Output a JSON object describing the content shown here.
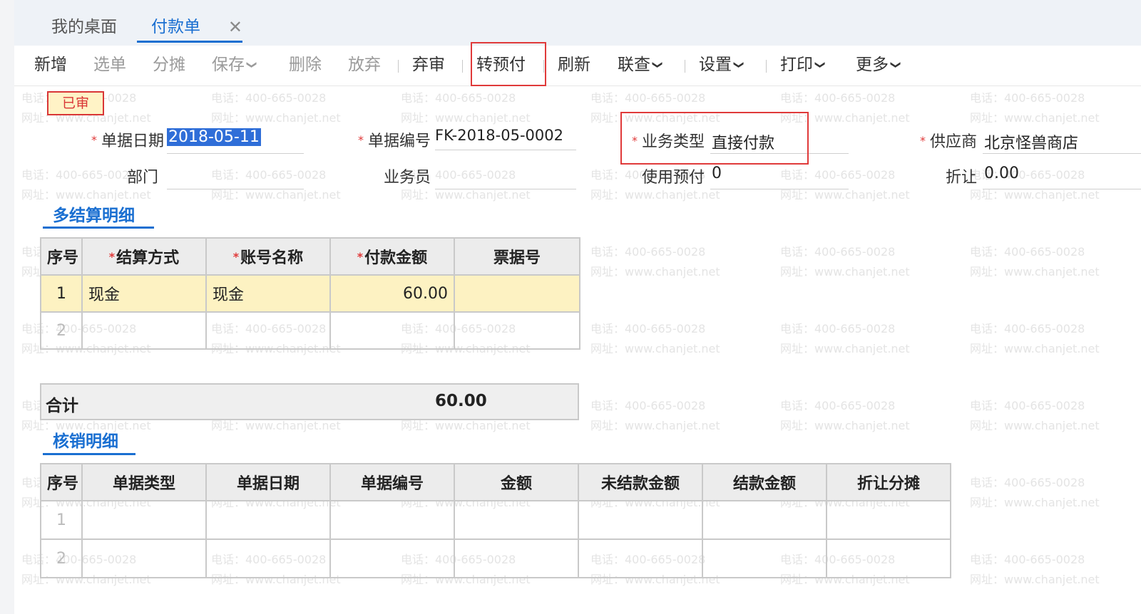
{
  "tabs": {
    "home": "我的桌面",
    "active": "付款单",
    "close_glyph": "✕"
  },
  "toolbar": {
    "new": "新增",
    "select_doc": "选单",
    "allocate": "分摊",
    "save": "保存",
    "delete": "删除",
    "discard": "放弃",
    "unapprove": "弃审",
    "to_prepayment": "转预付",
    "refresh": "刷新",
    "linked_query": "联查",
    "settings": "设置",
    "print": "打印",
    "more": "更多",
    "caret": "❯"
  },
  "form": {
    "status_badge": "已审",
    "required_mark": "*",
    "doc_date_label": "单据日期",
    "doc_date_value": "2018-05-11",
    "doc_no_label": "单据编号",
    "doc_no_value": "FK-2018-05-0002",
    "biz_type_label": "业务类型",
    "biz_type_value": "直接付款",
    "supplier_label": "供应商",
    "supplier_value": "北京怪兽商店",
    "dept_label": "部门",
    "dept_value": "",
    "salesman_label": "业务员",
    "salesman_value": "",
    "use_prepay_label": "使用预付",
    "use_prepay_value": "0",
    "discount_label": "折让",
    "discount_value": "0.00"
  },
  "settlement": {
    "title": "多结算明细",
    "headers": [
      "序号",
      "结算方式",
      "账号名称",
      "付款金额",
      "票据号"
    ],
    "rows": [
      {
        "no": "1",
        "method": "现金",
        "account": "现金",
        "amount": "60.00",
        "ticket": ""
      },
      {
        "no": "2",
        "method": "",
        "account": "",
        "amount": "",
        "ticket": ""
      }
    ],
    "total_label": "合计",
    "total_value": "60.00"
  },
  "writeoff": {
    "title": "核销明细",
    "headers": [
      "序号",
      "单据类型",
      "单据日期",
      "单据编号",
      "金额",
      "未结款金额",
      "结款金额",
      "折让分摊"
    ],
    "rows": [
      {
        "no": "1"
      },
      {
        "no": "2"
      }
    ]
  },
  "watermark": {
    "phone": "电话：400-665-0028",
    "site": "网址：www.chanjet.net"
  },
  "colors": {
    "accent": "#1a6fd1",
    "highlight_border": "#e03a3a",
    "selected_row": "#fdf2c2"
  }
}
